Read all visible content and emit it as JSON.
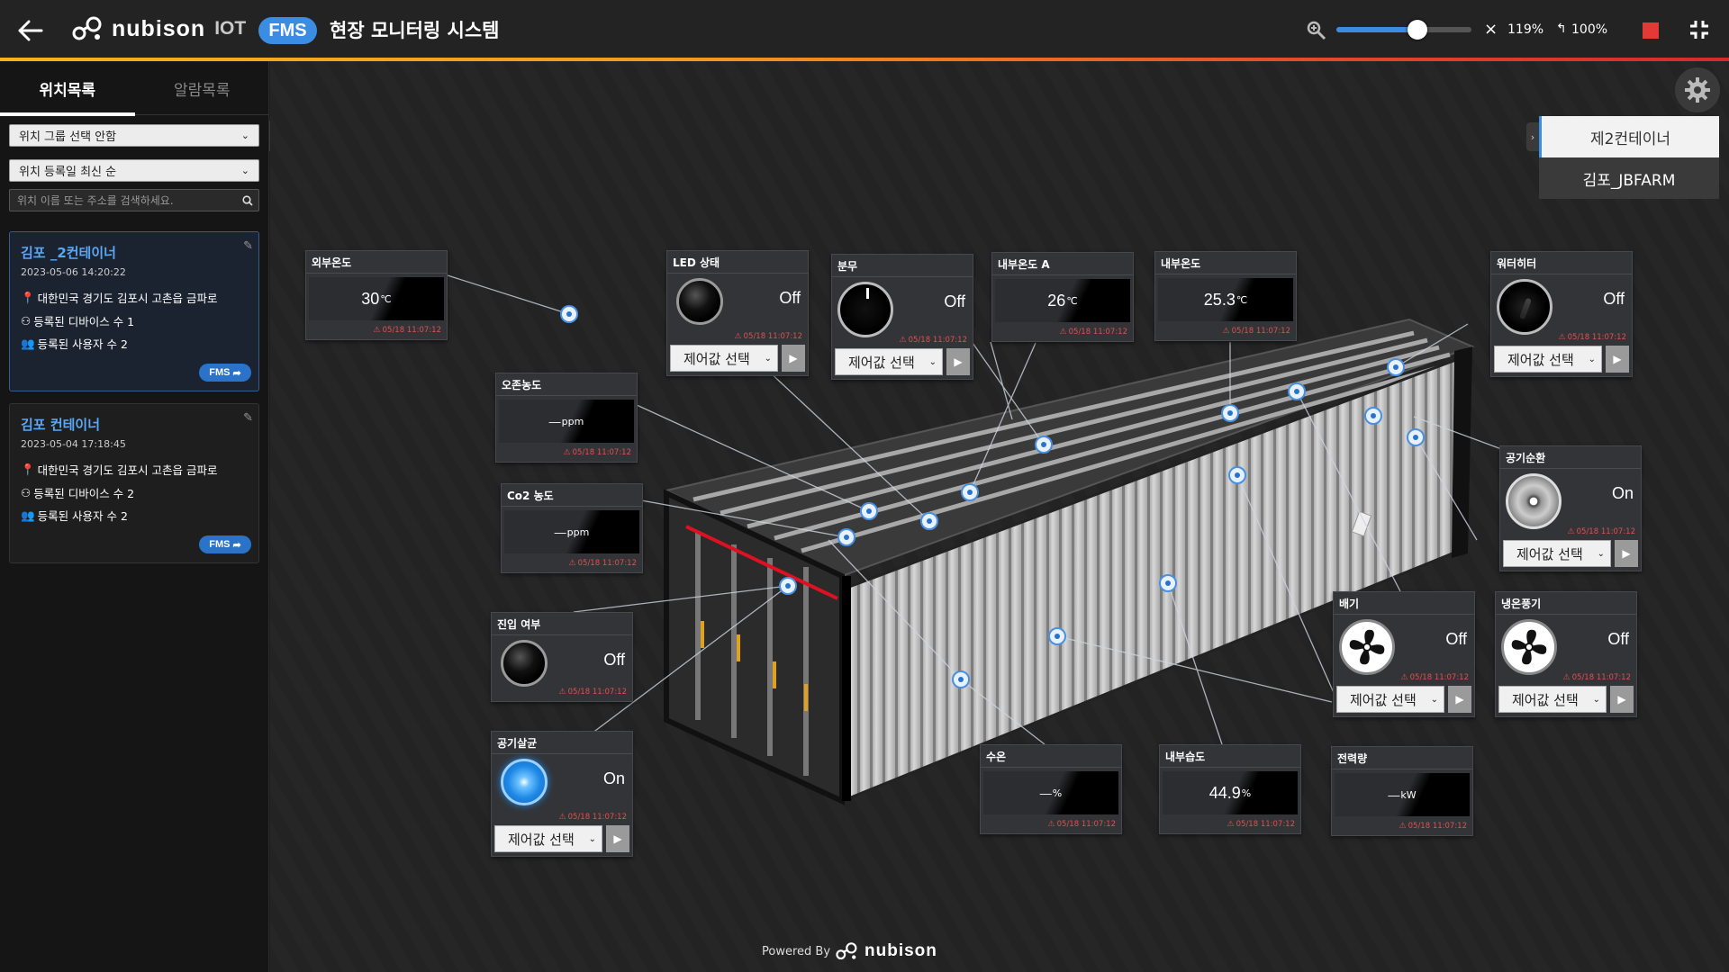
{
  "header": {
    "brand_name": "nubison",
    "brand_suffix": "IOT",
    "badge": "FMS",
    "title": "현장 모니터링 시스템",
    "zoom_percent": "119%",
    "zoom_level": 0.6,
    "reset_zoom": "100%",
    "close_symbol": "×"
  },
  "sidebar": {
    "tabs": [
      "위치목록",
      "알람목록"
    ],
    "active_tab": 0,
    "group_select": "위치 그룹 선택 안함",
    "sort_select": "위치 등록일 최신 순",
    "search_placeholder": "위치 이름 또는 주소를 검색하세요.",
    "locations": [
      {
        "name": "김포 _2컨테이너",
        "date": "2023-05-06 14:20:22",
        "address": "대한민국 경기도 김포시 고촌읍 금파로",
        "devices": "등록된 디바이스 수 1",
        "users": "등록된 사용자 수 2",
        "badge": "FMS"
      },
      {
        "name": "김포 컨테이너",
        "date": "2023-05-04 17:18:45",
        "address": "대한민국 경기도 김포시 고촌읍 금파로",
        "devices": "등록된 디바이스 수 2",
        "users": "등록된 사용자 수 2",
        "badge": "FMS"
      }
    ]
  },
  "location_popup": {
    "options": [
      "제2컨테이너",
      "김포_JBFARM"
    ],
    "selected": 0
  },
  "widgets": {
    "outdoor_temp": {
      "title": "외부온도",
      "value": "30",
      "unit": "℃",
      "time": "05/18 11:07:12"
    },
    "led": {
      "title": "LED 상태",
      "state": "Off",
      "control": "제어값 선택",
      "time": "05/18 11:07:12"
    },
    "spray": {
      "title": "분무",
      "state": "Off",
      "control": "제어값 선택",
      "time": "05/18 11:07:12"
    },
    "inner_temp_a": {
      "title": "내부온도 A",
      "value": "26",
      "unit": "℃",
      "time": "05/18 11:07:12"
    },
    "inner_temp": {
      "title": "내부온도",
      "value": "25.3",
      "unit": "℃",
      "time": "05/18 11:07:12"
    },
    "water_heater": {
      "title": "워터히터",
      "state": "Off",
      "control": "제어값 선택",
      "time": "05/18 11:07:12"
    },
    "ozone": {
      "title": "오존농도",
      "value": "—",
      "unit": "ppm",
      "time": "05/18 11:07:12"
    },
    "co2": {
      "title": "Co2 농도",
      "value": "—",
      "unit": "ppm",
      "time": "05/18 11:07:12"
    },
    "air_circulation": {
      "title": "공기순환",
      "state": "On",
      "control": "제어값 선택",
      "time": "05/18 11:07:12"
    },
    "entry": {
      "title": "진입 여부",
      "state": "Off",
      "time": "05/18 11:07:12"
    },
    "sterilizer": {
      "title": "공기살균",
      "state": "On",
      "control": "제어값 선택",
      "time": "05/18 11:07:12"
    },
    "exhaust": {
      "title": "배기",
      "state": "Off",
      "control": "제어값 선택",
      "time": "05/18 11:07:12"
    },
    "cooling_fan": {
      "title": "냉온풍기",
      "state": "Off",
      "control": "제어값 선택",
      "time": "05/18 11:07:12"
    },
    "water_temp": {
      "title": "수온",
      "value": "—",
      "unit": "%",
      "time": "05/18 11:07:12"
    },
    "inner_humidity": {
      "title": "내부습도",
      "value": "44.9",
      "unit": "%",
      "time": "05/18 11:07:12"
    },
    "power": {
      "title": "전력량",
      "value": "—",
      "unit": "kW",
      "time": "05/18 11:07:12"
    }
  },
  "footer": {
    "powered_by": "Powered By",
    "brand": "nubison"
  },
  "colors": {
    "accent": "#3b8de4",
    "alarm": "#e05050",
    "stop": "#e53935"
  }
}
